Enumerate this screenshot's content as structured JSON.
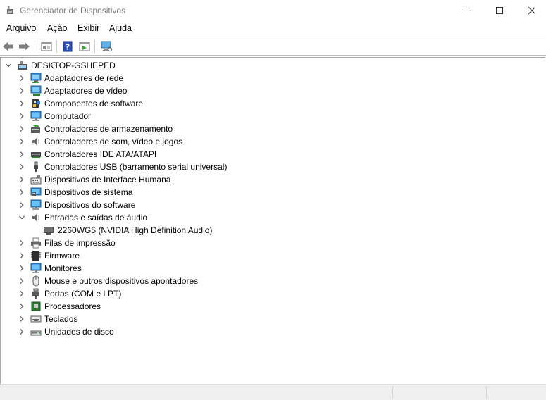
{
  "window": {
    "title": "Gerenciador de Dispositivos",
    "controls": {
      "minimize": "minimize-icon",
      "maximize": "maximize-icon",
      "close": "close-icon"
    }
  },
  "menu": {
    "items": [
      {
        "label": "Arquivo"
      },
      {
        "label": "Ação"
      },
      {
        "label": "Exibir"
      },
      {
        "label": "Ajuda"
      }
    ]
  },
  "toolbar": {
    "buttons": [
      "back-icon",
      "forward-icon",
      "properties-view-icon",
      "help-icon",
      "update-driver-icon",
      "scan-hardware-icon"
    ]
  },
  "tree": {
    "root": {
      "label": "DESKTOP-GSHEPED",
      "expanded": true,
      "icon": "computer-root-icon"
    },
    "categories": [
      {
        "label": "Adaptadores de rede",
        "icon": "network-adapter-icon"
      },
      {
        "label": "Adaptadores de vídeo",
        "icon": "display-adapter-icon"
      },
      {
        "label": "Componentes de software",
        "icon": "software-component-icon"
      },
      {
        "label": "Computador",
        "icon": "computer-icon"
      },
      {
        "label": "Controladores de armazenamento",
        "icon": "storage-controller-icon"
      },
      {
        "label": "Controladores de som, vídeo e jogos",
        "icon": "sound-icon"
      },
      {
        "label": "Controladores IDE ATA/ATAPI",
        "icon": "ide-controller-icon"
      },
      {
        "label": "Controladores USB (barramento serial universal)",
        "icon": "usb-icon"
      },
      {
        "label": "Dispositivos de Interface Humana",
        "icon": "hid-icon"
      },
      {
        "label": "Dispositivos de sistema",
        "icon": "system-device-icon"
      },
      {
        "label": "Dispositivos do software",
        "icon": "software-device-icon"
      },
      {
        "label": "Entradas e saídas de áudio",
        "icon": "audio-io-icon",
        "expanded": true,
        "children": [
          {
            "label": "2260WG5 (NVIDIA High Definition Audio)",
            "icon": "monitor-audio-icon"
          }
        ]
      },
      {
        "label": "Filas de impressão",
        "icon": "print-queue-icon"
      },
      {
        "label": "Firmware",
        "icon": "firmware-icon"
      },
      {
        "label": "Monitores",
        "icon": "monitor-icon"
      },
      {
        "label": "Mouse e outros dispositivos apontadores",
        "icon": "mouse-icon"
      },
      {
        "label": "Portas (COM e LPT)",
        "icon": "port-icon"
      },
      {
        "label": "Processadores",
        "icon": "processor-icon"
      },
      {
        "label": "Teclados",
        "icon": "keyboard-icon"
      },
      {
        "label": "Unidades de disco",
        "icon": "disk-drive-icon"
      }
    ]
  }
}
